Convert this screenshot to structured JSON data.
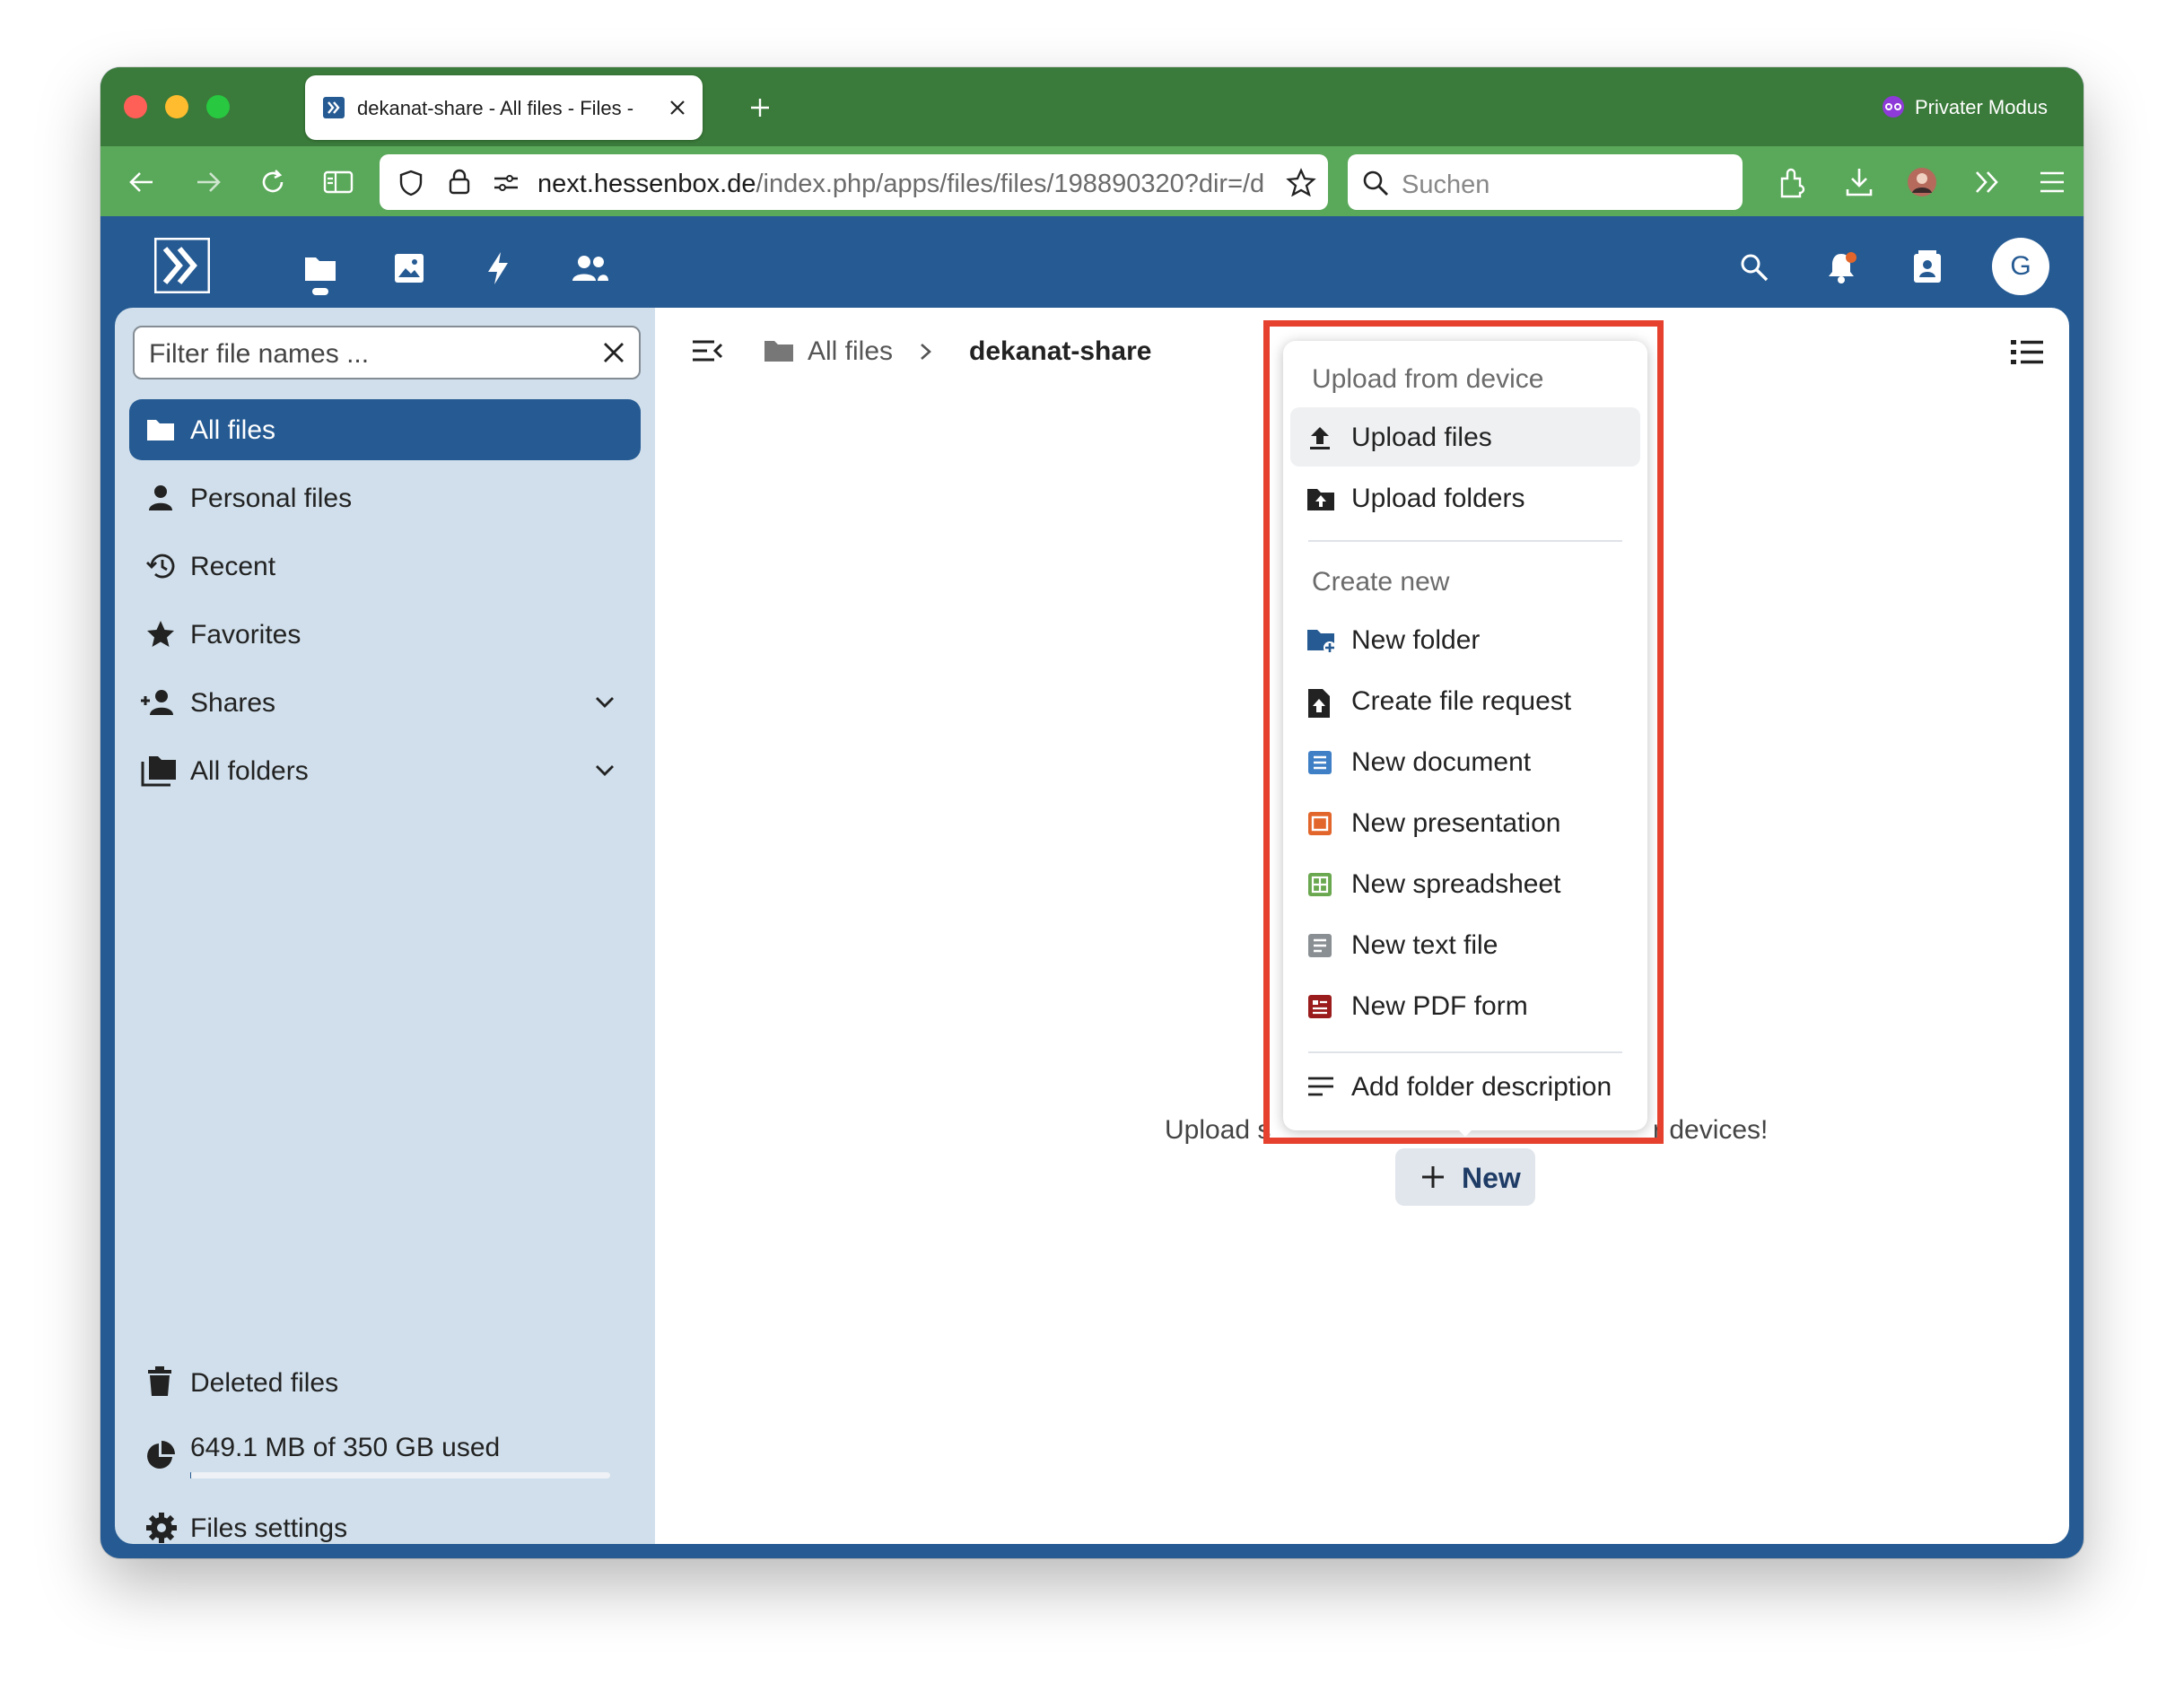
{
  "browser": {
    "tab_title": "dekanat-share - All files - Files - ",
    "private_mode_label": "Privater Modus",
    "url_host": "next.hessenbox.de",
    "url_path": "/index.php/apps/files/files/198890320?dir=/d",
    "search_placeholder": "Suchen"
  },
  "app": {
    "user_initial": "G"
  },
  "sidebar": {
    "filter_placeholder": "Filter file names ...",
    "items": [
      {
        "label": "All files",
        "icon": "folder-icon",
        "active": true
      },
      {
        "label": "Personal files",
        "icon": "person-icon"
      },
      {
        "label": "Recent",
        "icon": "history-icon"
      },
      {
        "label": "Favorites",
        "icon": "star-icon"
      },
      {
        "label": "Shares",
        "icon": "share-icon"
      },
      {
        "label": "All folders",
        "icon": "folders-icon"
      }
    ],
    "deleted_files": "Deleted files",
    "quota": "649.1 MB of 350 GB used",
    "quota_fraction": 0.0018,
    "settings": "Files settings"
  },
  "breadcrumb": {
    "root": "All files",
    "current": "dekanat-share"
  },
  "empty_state": {
    "left_text": "Upload s",
    "right_text": "r devices!"
  },
  "new_button": {
    "label": "New"
  },
  "new_menu": {
    "upload_section": "Upload from device",
    "upload_files": "Upload files",
    "upload_folders": "Upload folders",
    "create_section": "Create new",
    "new_folder": "New folder",
    "file_request": "Create file request",
    "new_document": "New document",
    "new_presentation": "New presentation",
    "new_spreadsheet": "New spreadsheet",
    "new_text_file": "New text file",
    "new_pdf_form": "New PDF form",
    "folder_description": "Add folder description"
  },
  "colors": {
    "header_blue": "#255a93",
    "tabbar_green": "#3a7a3a",
    "highlight_red": "#e5412e",
    "document_blue": "#3f7fc6",
    "presentation_orange": "#e2662b",
    "spreadsheet_green": "#6aa84f",
    "pdf_red": "#9b1c1c"
  }
}
